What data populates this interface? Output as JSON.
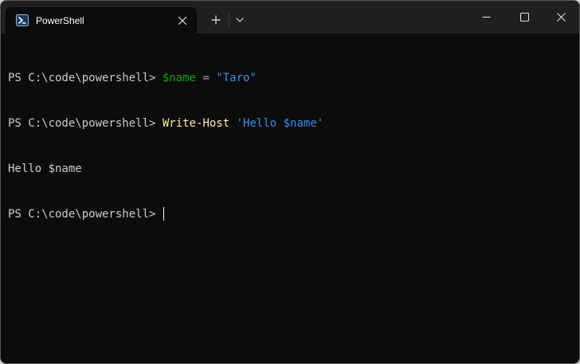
{
  "window": {
    "tab_title": "PowerShell",
    "tab_icon": "powershell-icon",
    "icons": {
      "close_tab": "close-icon",
      "new_tab": "plus-icon",
      "dropdown": "chevron-down-icon",
      "minimize": "minimize-icon",
      "maximize": "maximize-icon",
      "close_window": "close-icon"
    }
  },
  "terminal": {
    "lines": [
      {
        "prompt": "PS C:\\code\\powershell> ",
        "var": "$name",
        "op": " = ",
        "str": "\"Taro\""
      },
      {
        "prompt": "PS C:\\code\\powershell> ",
        "cmd": "Write-Host",
        "space": " ",
        "str": "'Hello $name'"
      },
      {
        "output": "Hello $name"
      },
      {
        "prompt": "PS C:\\code\\powershell> "
      }
    ]
  },
  "colors": {
    "background": "#0c0c0c",
    "titlebar": "#202020",
    "variable": "#13a10e",
    "string": "#3b8eea",
    "command": "#f9f1a5",
    "text": "#cccccc"
  }
}
